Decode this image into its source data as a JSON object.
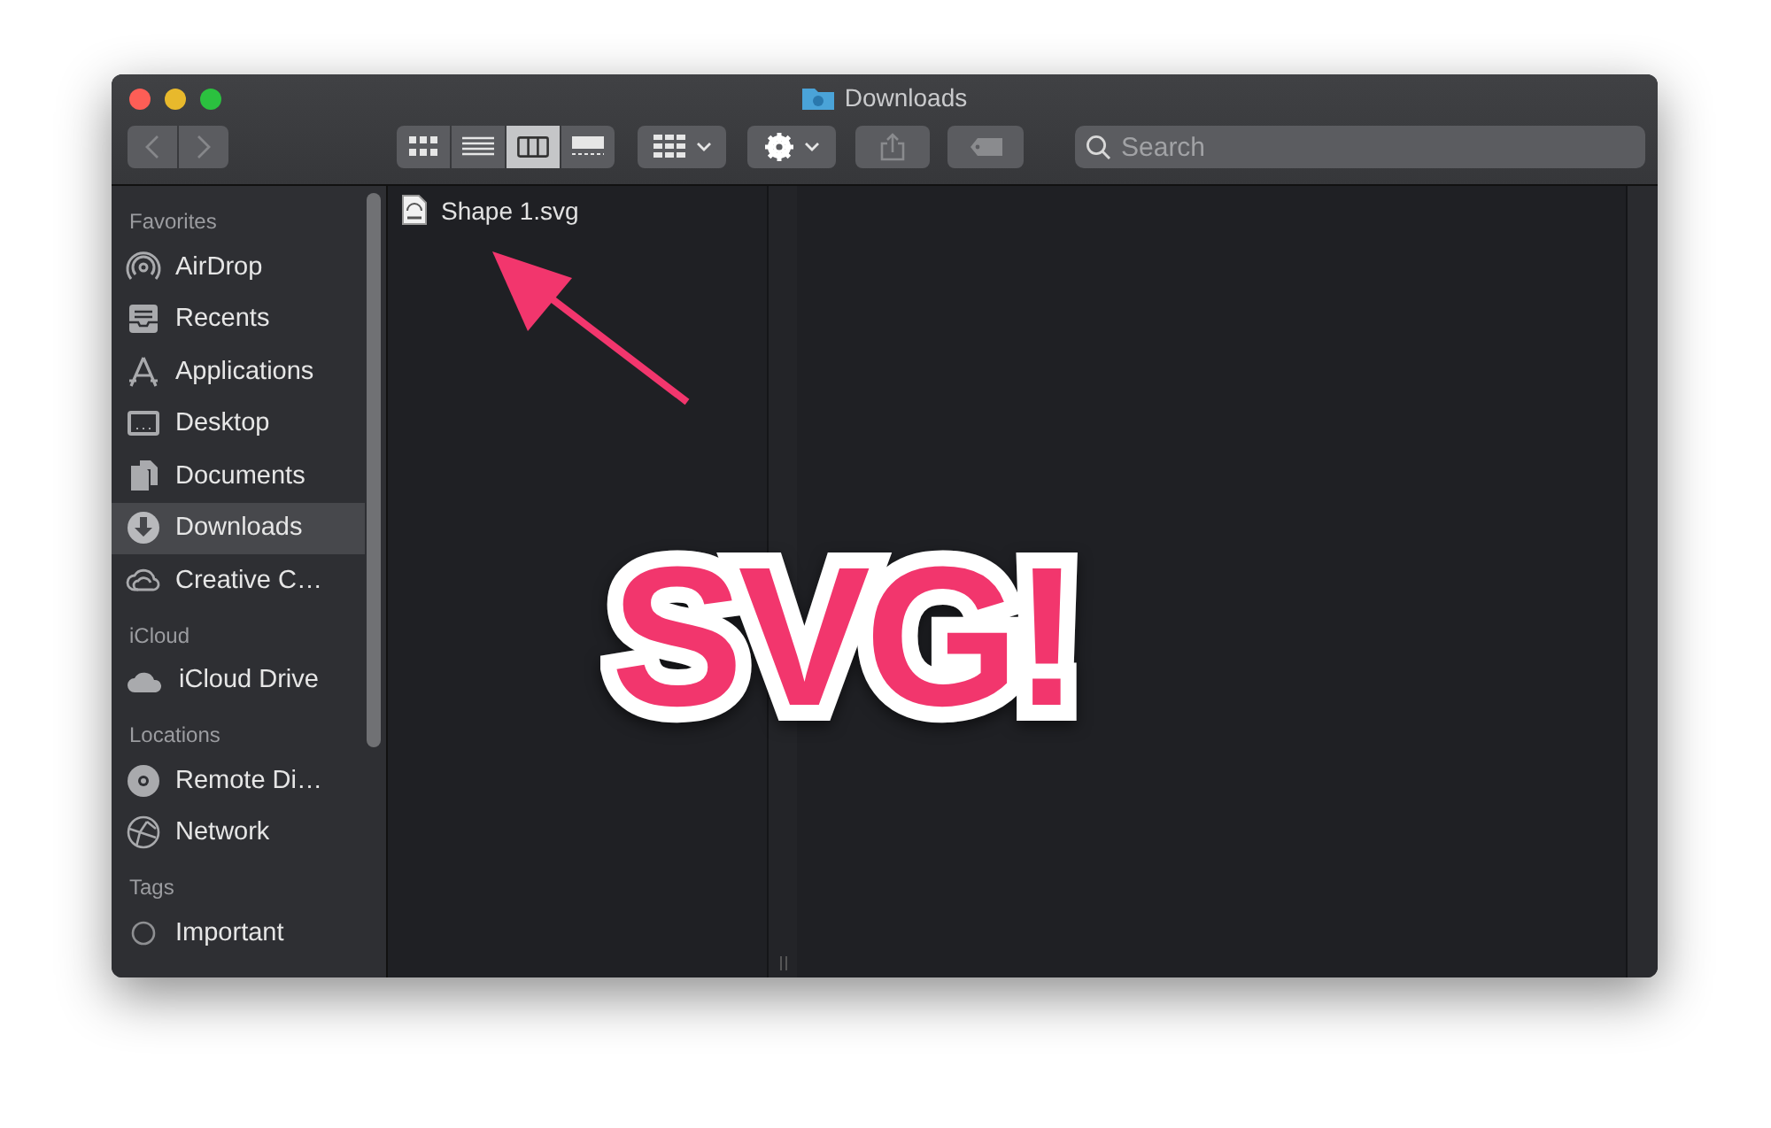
{
  "window": {
    "title": "Downloads"
  },
  "toolbar": {
    "view_modes": [
      {
        "selected": false
      },
      {
        "selected": false
      },
      {
        "selected": true
      },
      {
        "selected": false
      }
    ],
    "search": {
      "placeholder": "Search"
    }
  },
  "sidebar": {
    "sections": [
      {
        "heading": "Favorites",
        "items": [
          {
            "label": "AirDrop",
            "selected": false
          },
          {
            "label": "Recents",
            "selected": false
          },
          {
            "label": "Applications",
            "selected": false
          },
          {
            "label": "Desktop",
            "selected": false
          },
          {
            "label": "Documents",
            "selected": false
          },
          {
            "label": "Downloads",
            "selected": true
          },
          {
            "label": "Creative C…",
            "selected": false
          }
        ]
      },
      {
        "heading": "iCloud",
        "items": [
          {
            "label": "iCloud Drive",
            "selected": false
          }
        ]
      },
      {
        "heading": "Locations",
        "items": [
          {
            "label": "Remote Di…",
            "selected": false
          },
          {
            "label": "Network",
            "selected": false
          }
        ]
      },
      {
        "heading": "Tags",
        "items": [
          {
            "label": "Important",
            "selected": false
          }
        ]
      }
    ]
  },
  "files": [
    {
      "name": "Shape 1.svg"
    }
  ],
  "annotation": {
    "text": "SVG!"
  }
}
